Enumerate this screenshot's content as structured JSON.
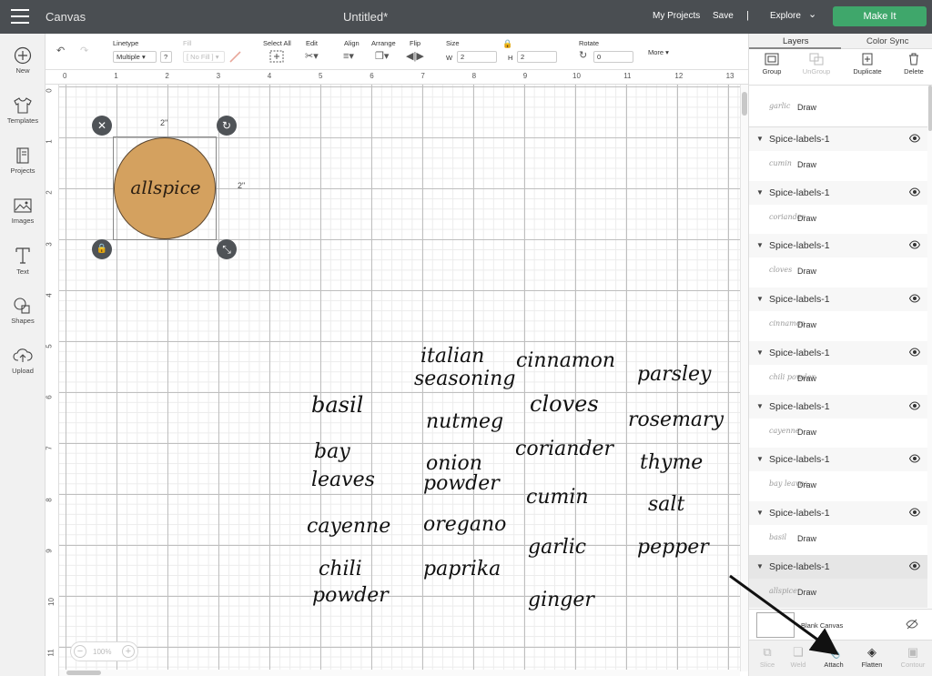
{
  "topbar": {
    "app_title": "Canvas",
    "doc_title": "Untitled*",
    "my_projects": "My Projects",
    "save": "Save",
    "separator": "|",
    "explore": "Explore",
    "make_it": "Make It"
  },
  "leftbar": {
    "new": "New",
    "templates": "Templates",
    "projects": "Projects",
    "images": "Images",
    "text": "Text",
    "shapes": "Shapes",
    "upload": "Upload"
  },
  "toolbar": {
    "linetype_label": "Linetype",
    "linetype_value": "Multiple",
    "linetype_help": "?",
    "fill_label": "Fill",
    "fill_value": "[ No Fill ]",
    "select_all": "Select All",
    "edit": "Edit",
    "align": "Align",
    "arrange": "Arrange",
    "flip": "Flip",
    "size": "Size",
    "w_label": "W",
    "w_value": "2",
    "h_label": "H",
    "h_value": "2",
    "rotate": "Rotate",
    "rotate_value": "0",
    "more": "More"
  },
  "ruler": {
    "top": [
      "0",
      "1",
      "2",
      "3",
      "4",
      "5",
      "6",
      "7",
      "8",
      "9",
      "10",
      "11",
      "12",
      "13"
    ],
    "left": [
      "0",
      "1",
      "2",
      "3",
      "4",
      "5",
      "6",
      "7",
      "8",
      "9",
      "10",
      "11"
    ]
  },
  "zoom": {
    "value": "100%"
  },
  "selection": {
    "width_label": "2\"",
    "height_label": "2\"",
    "circle_text": "allspice"
  },
  "words": {
    "italian": "italian",
    "seasoning": "seasoning",
    "cinnamon": "cinnamon",
    "parsley": "parsley",
    "basil": "basil",
    "nutmeg": "nutmeg",
    "cloves": "cloves",
    "rosemary": "rosemary",
    "bay": "bay",
    "leaves": "leaves",
    "onion": "onion",
    "powder1": "powder",
    "coriander": "coriander",
    "thyme": "thyme",
    "cumin": "cumin",
    "salt": "salt",
    "cayenne": "cayenne",
    "oregano": "oregano",
    "garlic": "garlic",
    "pepper": "pepper",
    "chili": "chili",
    "powder2": "powder",
    "paprika": "paprika",
    "ginger": "ginger"
  },
  "panel": {
    "tab_layers": "Layers",
    "tab_color_sync": "Color Sync",
    "actions": {
      "group": "Group",
      "ungroup": "UnGroup",
      "duplicate": "Duplicate",
      "delete": "Delete"
    },
    "top_partial": {
      "thumb": "garlic",
      "op": "Draw"
    },
    "layers": [
      {
        "name": "Spice-labels-1",
        "thumb": "cumin",
        "op": "Draw"
      },
      {
        "name": "Spice-labels-1",
        "thumb": "coriander",
        "op": "Draw"
      },
      {
        "name": "Spice-labels-1",
        "thumb": "cloves",
        "op": "Draw"
      },
      {
        "name": "Spice-labels-1",
        "thumb": "cinnamon",
        "op": "Draw"
      },
      {
        "name": "Spice-labels-1",
        "thumb": "chili powder",
        "op": "Draw"
      },
      {
        "name": "Spice-labels-1",
        "thumb": "cayenne",
        "op": "Draw"
      },
      {
        "name": "Spice-labels-1",
        "thumb": "bay leaves",
        "op": "Draw"
      },
      {
        "name": "Spice-labels-1",
        "thumb": "basil",
        "op": "Draw"
      },
      {
        "name": "Spice-labels-1",
        "thumb": "allspice",
        "op": "Draw"
      }
    ],
    "blank_canvas": "Blank Canvas",
    "bottom": {
      "slice": "Slice",
      "weld": "Weld",
      "attach": "Attach",
      "flatten": "Flatten",
      "contour": "Contour"
    }
  }
}
